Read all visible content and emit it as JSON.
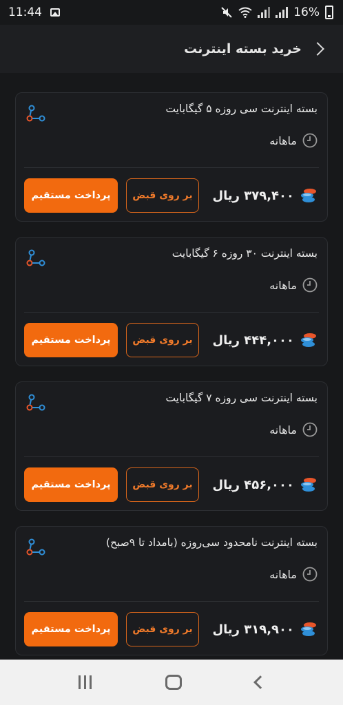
{
  "status": {
    "time": "11:44",
    "battery": "16%"
  },
  "header": {
    "title": "خرید بسته اینترنت"
  },
  "packages": [
    {
      "title": "بسته اینترنت سی روزه ۵ گیگابایت",
      "period": "ماهانه",
      "price": "۳۷۹,۴۰۰ ریال",
      "bill_label": "بر روی قبض",
      "direct_label": "پرداخت مستقیم"
    },
    {
      "title": "بسته اینترنت ۳۰ روزه ۶ گیگابایت",
      "period": "ماهانه",
      "price": "۴۴۴,۰۰۰ ریال",
      "bill_label": "بر روی قبض",
      "direct_label": "پرداخت مستقیم"
    },
    {
      "title": "بسته اینترنت سی روزه ۷ گیگابایت",
      "period": "ماهانه",
      "price": "۴۵۶,۰۰۰ ریال",
      "bill_label": "بر روی قبض",
      "direct_label": "پرداخت مستقیم"
    },
    {
      "title": "بسته اینترنت نامحدود سی‌روزه (بامداد تا ۹صبح)",
      "period": "ماهانه",
      "price": "۳۱۹,۹۰۰ ریال",
      "bill_label": "بر روی قبض",
      "direct_label": "پرداخت مستقیم"
    }
  ],
  "colors": {
    "accent": "#f26a0f",
    "background": "#17181a",
    "card": "#1b1c1f",
    "icon_blue": "#2f8fd8"
  },
  "icons": [
    "image-icon",
    "mute-icon",
    "wifi-icon",
    "signal-icon",
    "battery-icon",
    "back-arrow-icon",
    "share-icon",
    "clock-icon",
    "coins-icon",
    "recents-icon",
    "home-icon",
    "nav-back-icon"
  ]
}
